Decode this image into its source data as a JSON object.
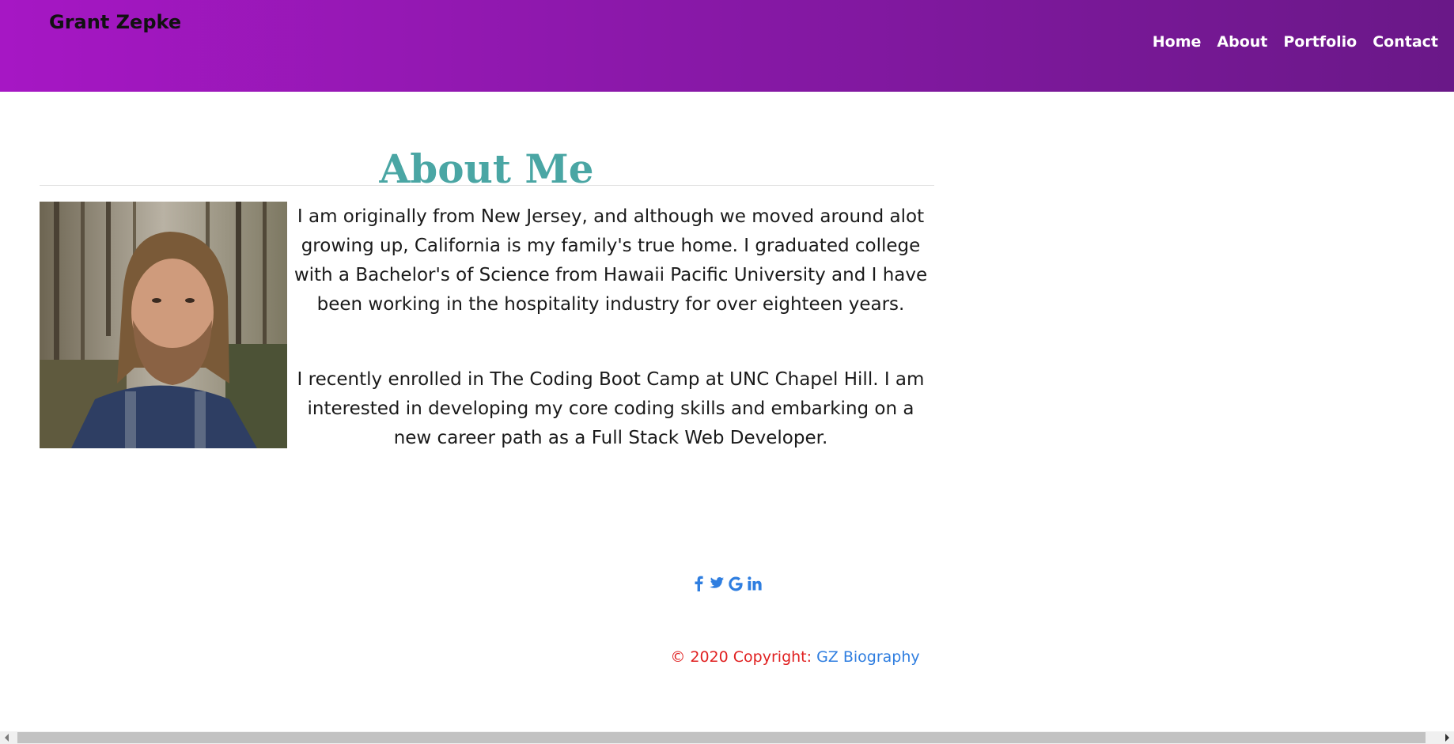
{
  "header": {
    "brand": "Grant Zepke",
    "nav": [
      "Home",
      "About",
      "Portfolio",
      "Contact"
    ],
    "gradient_colors": [
      "#a617c4",
      "#6a1888"
    ]
  },
  "main": {
    "title": "About Me",
    "title_color": "#4aa6a4",
    "photo_alt": "portrait photo",
    "paragraphs": [
      "I am originally from New Jersey, and although we moved around alot growing up, California is my family's true home. I graduated college with a Bachelor's of Science from Hawaii Pacific University and I have been working in the hospitality industry for over eighteen years.",
      "I recently enrolled in The Coding Boot Camp at UNC Chapel Hill. I am interested in developing my core coding skills and embarking on a new career path as a Full Stack Web Developer."
    ]
  },
  "footer": {
    "social_icons": [
      "facebook-icon",
      "twitter-icon",
      "google-icon",
      "linkedin-icon"
    ],
    "icon_color": "#2f7ee0",
    "copyright_text": "© 2020 Copyright: ",
    "copyright_link": "GZ Biography",
    "copyright_text_color": "#e02020"
  }
}
